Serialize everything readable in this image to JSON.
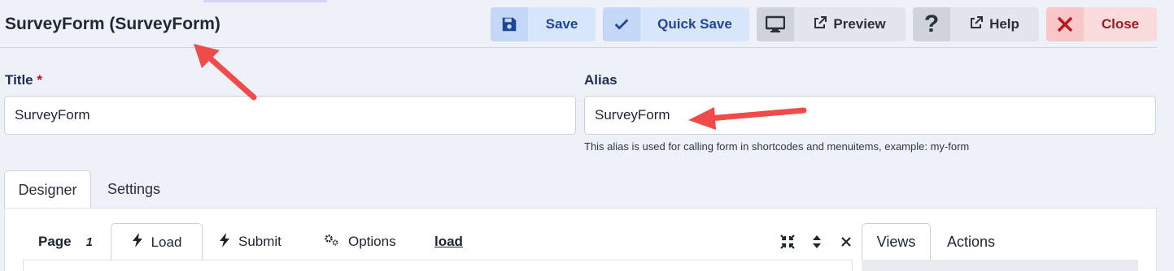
{
  "page": {
    "title": "SurveyForm (SurveyForm)"
  },
  "toolbar": {
    "save_label": "Save",
    "quick_save_label": "Quick Save",
    "preview_label": "Preview",
    "help_label": "Help",
    "close_label": "Close"
  },
  "fields": {
    "title": {
      "label": "Title",
      "required_marker": "*",
      "value": "SurveyForm"
    },
    "alias": {
      "label": "Alias",
      "value": "SurveyForm",
      "hint": "This alias is used for calling form in shortcodes and menuitems, example: my-form"
    }
  },
  "tabs": [
    {
      "label": "Designer",
      "active": true
    },
    {
      "label": "Settings",
      "active": false
    }
  ],
  "designer": {
    "page_label": "Page",
    "page_number": "1",
    "subtabs": [
      {
        "label": "Load",
        "active": true
      },
      {
        "label": "Submit",
        "active": false
      },
      {
        "label": "Options",
        "active": false
      }
    ],
    "load_link": "load",
    "side_tabs": [
      {
        "label": "Views",
        "active": true
      },
      {
        "label": "Actions",
        "active": false
      }
    ]
  },
  "colors": {
    "background": "#eef1f8",
    "primary_button": "#d8e6fc",
    "neutral_button": "#e2e5eb",
    "danger_button": "#fbdcdc",
    "annotation_arrow": "#ef4b4b"
  }
}
